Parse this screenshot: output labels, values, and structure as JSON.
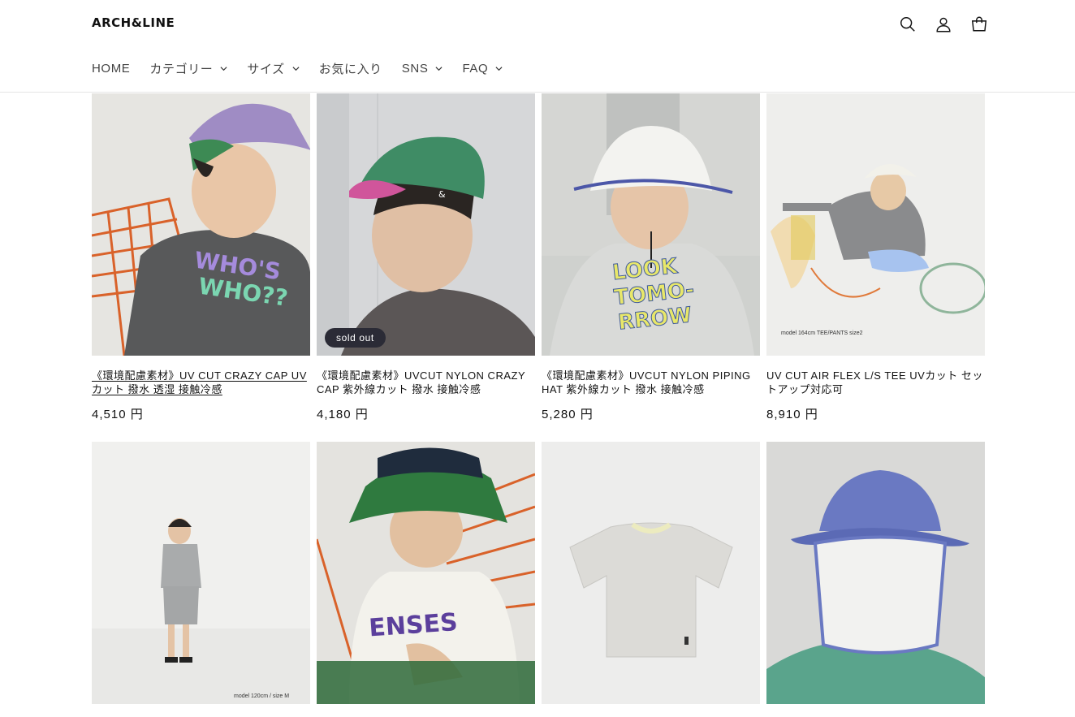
{
  "header": {
    "logo": "ARCH&LINE",
    "icons": [
      "search-icon",
      "account-icon",
      "cart-icon"
    ]
  },
  "nav": [
    {
      "label": "HOME",
      "has_dropdown": false
    },
    {
      "label": "カテゴリー",
      "has_dropdown": true
    },
    {
      "label": "サイズ",
      "has_dropdown": true
    },
    {
      "label": "お気に入り",
      "has_dropdown": false
    },
    {
      "label": "SNS",
      "has_dropdown": true
    },
    {
      "label": "FAQ",
      "has_dropdown": true
    }
  ],
  "products": [
    {
      "title": "《環境配慮素材》UV CUT CRAZY CAP UVカット 撥水 透湿 接触冷感",
      "price": "4,510 円",
      "badge": "",
      "print": "WHO'S WHO??",
      "caption": ""
    },
    {
      "title": "《環境配慮素材》UVCUT NYLON CRAZY CAP 紫外線カット 撥水 接触冷感",
      "price": "4,180 円",
      "badge": "sold out",
      "print": "",
      "caption": ""
    },
    {
      "title": "《環境配慮素材》UVCUT NYLON PIPING HAT 紫外線カット 撥水 接触冷感",
      "price": "5,280 円",
      "badge": "",
      "print": "LOOK TOMO- RROW",
      "caption": ""
    },
    {
      "title": "UV CUT AIR FLEX L/S TEE UVカット セットアップ対応可",
      "price": "8,910 円",
      "badge": "",
      "print": "",
      "caption": "model 164cm TEE/PANTS size2"
    },
    {
      "title": "",
      "price": "",
      "badge": "",
      "print": "",
      "caption": "model 120cm / size M"
    },
    {
      "title": "",
      "price": "",
      "badge": "",
      "print": "ENSES",
      "caption": ""
    },
    {
      "title": "",
      "price": "",
      "badge": "",
      "print": "",
      "caption": ""
    },
    {
      "title": "",
      "price": "",
      "badge": "",
      "print": "",
      "caption": ""
    }
  ],
  "colors": {
    "badge_bg": "#2b2b36",
    "text": "#121212",
    "border": "#e6e6e6"
  }
}
